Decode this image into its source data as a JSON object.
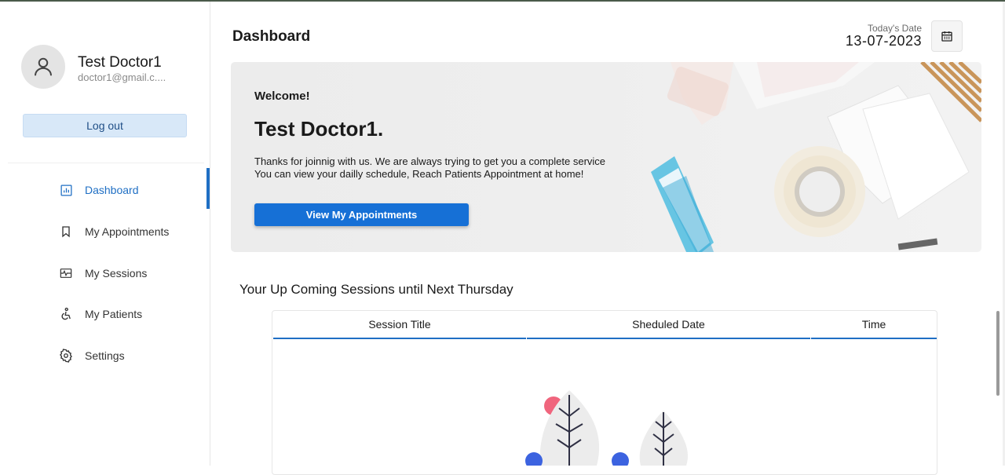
{
  "profile": {
    "name": "Test Doctor1",
    "email": "doctor1@gmail.c...."
  },
  "logout_label": "Log out",
  "nav": [
    {
      "label": "Dashboard",
      "icon": "chart-icon",
      "active": true
    },
    {
      "label": "My Appointments",
      "icon": "bookmark-icon",
      "active": false
    },
    {
      "label": "My Sessions",
      "icon": "sessions-icon",
      "active": false
    },
    {
      "label": "My Patients",
      "icon": "accessible-icon",
      "active": false
    },
    {
      "label": "Settings",
      "icon": "gear-icon",
      "active": false
    }
  ],
  "header": {
    "title": "Dashboard",
    "date_label": "Today's Date",
    "date_value": "13-07-2023"
  },
  "banner": {
    "welcome": "Welcome!",
    "doctor_name": "Test Doctor1.",
    "line1": "Thanks for joinnig with us. We are always trying to get you a complete service",
    "line2": "You can view your dailly schedule, Reach Patients Appointment at home!",
    "button_label": "View My Appointments"
  },
  "sessions": {
    "title": "Your Up Coming Sessions until Next Thursday",
    "columns": [
      "Session Title",
      "Sheduled Date",
      "Time"
    ]
  },
  "colors": {
    "accent": "#1f6fc4",
    "button": "#1670d6",
    "logout_bg": "#d8e8f8"
  }
}
